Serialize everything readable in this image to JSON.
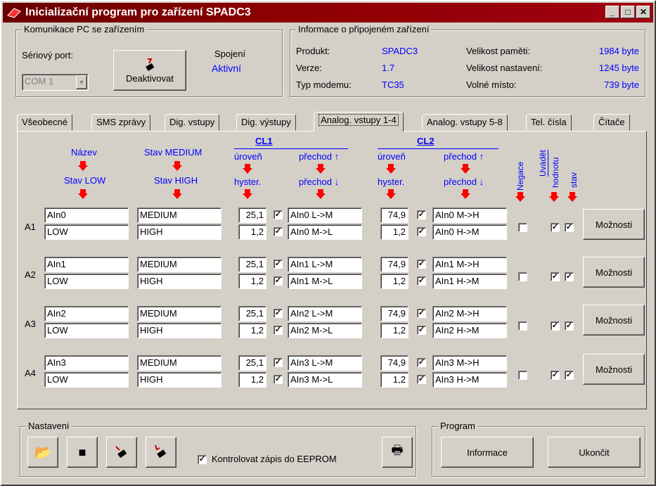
{
  "window": {
    "title": "Inicializační program pro zařízení SPADC3",
    "min": "_",
    "max": "□",
    "close": "✕"
  },
  "comm": {
    "legend": "Komunikace PC se zařízením",
    "port_label": "Sériový port:",
    "port_value": "COM 1",
    "conn_label": "Spojení",
    "conn_status": "Aktivní",
    "deactivate": "Deaktivovat"
  },
  "info": {
    "legend": "Informace o připojeném zařízení",
    "product_label": "Produkt:",
    "product": "SPADC3",
    "version_label": "Verze:",
    "version": "1.7",
    "modem_label": "Typ modemu:",
    "modem": "TC35",
    "mem_label": "Velikost paměti:",
    "mem": "1984 byte",
    "set_label": "Velikost nastavení:",
    "set": "1245 byte",
    "free_label": "Volné místo:",
    "free": "739 byte"
  },
  "tabs": [
    "Všeobecné",
    "SMS zprávy",
    "Dig. vstupy",
    "Dig. výstupy",
    "Analog. vstupy 1-4",
    "Analog. vstupy 5-8",
    "Tel. čísla",
    "Čítače"
  ],
  "headers": {
    "nazev": "Název",
    "stav_low": "Stav LOW",
    "stav_medium": "Stav MEDIUM",
    "stav_high": "Stav HIGH",
    "cl1": "CL1",
    "cl2": "CL2",
    "uroven": "úroveň",
    "hyster": "hyster.",
    "prechod_up": "přechod ↑",
    "prechod_down": "přechod ↓",
    "negace": "Negace",
    "uvadet": "Uvádět",
    "hodnotu": "hodnotu",
    "stav": "stav"
  },
  "rows": [
    {
      "label": "A1",
      "name": "AIn0",
      "low": "LOW",
      "medium": "MEDIUM",
      "high": "HIGH",
      "cl1_level": "25,1",
      "cl1_hyst": "1,2",
      "cl1_up": "AIn0 L->M",
      "cl1_down": "AIn0 M->L",
      "cl2_level": "74,9",
      "cl2_hyst": "1,2",
      "cl2_up": "AIn0 M->H",
      "cl2_down": "AIn0 H->M",
      "options": "Možnosti"
    },
    {
      "label": "A2",
      "name": "AIn1",
      "low": "LOW",
      "medium": "MEDIUM",
      "high": "HIGH",
      "cl1_level": "25,1",
      "cl1_hyst": "1,2",
      "cl1_up": "AIn1 L->M",
      "cl1_down": "AIn1 M->L",
      "cl2_level": "74,9",
      "cl2_hyst": "1,2",
      "cl2_up": "AIn1 M->H",
      "cl2_down": "AIn1 H->M",
      "options": "Možnosti"
    },
    {
      "label": "A3",
      "name": "AIn2",
      "low": "LOW",
      "medium": "MEDIUM",
      "high": "HIGH",
      "cl1_level": "25,1",
      "cl1_hyst": "1,2",
      "cl1_up": "AIn2 L->M",
      "cl1_down": "AIn2 M->L",
      "cl2_level": "74,9",
      "cl2_hyst": "1,2",
      "cl2_up": "AIn2 M->H",
      "cl2_down": "AIn2 H->M",
      "options": "Možnosti"
    },
    {
      "label": "A4",
      "name": "AIn3",
      "low": "LOW",
      "medium": "MEDIUM",
      "high": "HIGH",
      "cl1_level": "25,1",
      "cl1_hyst": "1,2",
      "cl1_up": "AIn3 L->M",
      "cl1_down": "AIn3 M->L",
      "cl2_level": "74,9",
      "cl2_hyst": "1,2",
      "cl2_up": "AIn3 M->H",
      "cl2_down": "AIn3 H->M",
      "options": "Možnosti"
    }
  ],
  "settings": {
    "legend": "Nastavení",
    "verify": "Kontrolovat zápis do EEPROM",
    "verify_checked": "✓"
  },
  "program": {
    "legend": "Program",
    "info": "Informace",
    "quit": "Ukončit"
  },
  "check_mark": "✓",
  "colors": {
    "title": "#8b0000",
    "accent": "#0000ff",
    "arrow": "#ff0000",
    "face": "#d4d0c8"
  }
}
